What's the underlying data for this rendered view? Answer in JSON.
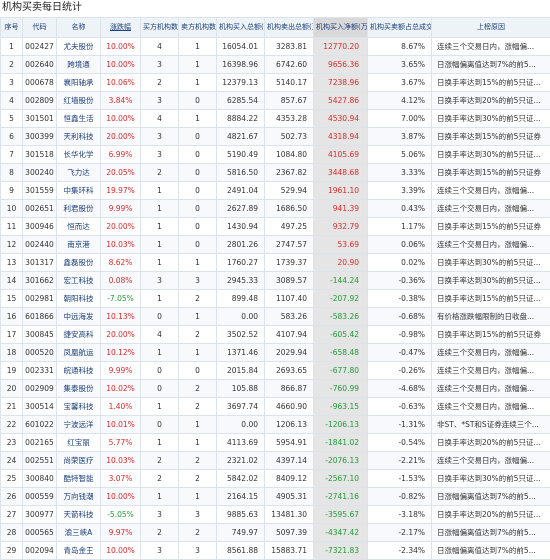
{
  "page_title": "机构买卖每日统计",
  "columns": {
    "seq": "序号",
    "code": "代码",
    "name": "名称",
    "change": "涨跌幅",
    "buyer_count": "买方机构数",
    "seller_count": "卖方机构数",
    "buy_amount": "机构买入总额(万)",
    "sell_amount": "机构卖出总额(万)",
    "net_buy": "机构买入净额(万)",
    "ratio": "机构买卖额占总成交额比",
    "reason": "上榜原因"
  },
  "colors": {
    "up": "#e12828",
    "down": "#1d9b37",
    "header_text": "#1a3e7a"
  },
  "rows": [
    {
      "seq": "1",
      "code": "002427",
      "name": "尤夫股份",
      "change": "10.00%",
      "buyers": "4",
      "sellers": "1",
      "buy": "16054.01",
      "sell": "3283.81",
      "net": "12770.20",
      "ratio": "8.67%",
      "reason": "连续三个交易日内，涨幅偏...",
      "dir": "up",
      "net_dir": "up"
    },
    {
      "seq": "2",
      "code": "002640",
      "name": "跨境通",
      "change": "10.00%",
      "buyers": "3",
      "sellers": "1",
      "buy": "16398.96",
      "sell": "6742.60",
      "net": "9656.36",
      "ratio": "3.65%",
      "reason": "日涨幅偏离值达到7%的前5...",
      "dir": "up",
      "net_dir": "up"
    },
    {
      "seq": "3",
      "code": "000678",
      "name": "襄阳轴承",
      "change": "10.06%",
      "buyers": "2",
      "sellers": "1",
      "buy": "12379.13",
      "sell": "5140.17",
      "net": "7238.96",
      "ratio": "3.67%",
      "reason": "日换手率达到15%的前5只证...",
      "dir": "up",
      "net_dir": "up"
    },
    {
      "seq": "4",
      "code": "002809",
      "name": "红墙股份",
      "change": "3.84%",
      "buyers": "3",
      "sellers": "0",
      "buy": "6285.54",
      "sell": "857.67",
      "net": "5427.86",
      "ratio": "4.12%",
      "reason": "日换手率达到20%的前5只证...",
      "dir": "up",
      "net_dir": "up"
    },
    {
      "seq": "5",
      "code": "301501",
      "name": "恒鑫生活",
      "change": "10.00%",
      "buyers": "4",
      "sellers": "1",
      "buy": "8884.22",
      "sell": "4353.28",
      "net": "4530.94",
      "ratio": "7.00%",
      "reason": "日换手率达到30%的前5只证...",
      "dir": "up",
      "net_dir": "up"
    },
    {
      "seq": "6",
      "code": "300399",
      "name": "天利科技",
      "change": "20.00%",
      "buyers": "3",
      "sellers": "0",
      "buy": "4821.67",
      "sell": "502.73",
      "net": "4318.94",
      "ratio": "3.87%",
      "reason": "日换手率达到15%的前5只证券",
      "dir": "up",
      "net_dir": "up"
    },
    {
      "seq": "7",
      "code": "301518",
      "name": "长华化学",
      "change": "6.99%",
      "buyers": "3",
      "sellers": "0",
      "buy": "5190.49",
      "sell": "1084.80",
      "net": "4105.69",
      "ratio": "5.06%",
      "reason": "日换手率达到30%的前5只证...",
      "dir": "up",
      "net_dir": "up"
    },
    {
      "seq": "8",
      "code": "300240",
      "name": "飞力达",
      "change": "20.05%",
      "buyers": "2",
      "sellers": "0",
      "buy": "5816.50",
      "sell": "2367.82",
      "net": "3448.68",
      "ratio": "3.33%",
      "reason": "日换手率达到15%的前5只证券",
      "dir": "up",
      "net_dir": "up"
    },
    {
      "seq": "9",
      "code": "301559",
      "name": "中集环科",
      "change": "19.97%",
      "buyers": "1",
      "sellers": "0",
      "buy": "2491.04",
      "sell": "529.94",
      "net": "1961.10",
      "ratio": "3.39%",
      "reason": "连续三个交易日内，涨幅偏...",
      "dir": "up",
      "net_dir": "up"
    },
    {
      "seq": "10",
      "code": "002651",
      "name": "利君股份",
      "change": "9.99%",
      "buyers": "1",
      "sellers": "0",
      "buy": "2627.89",
      "sell": "1686.50",
      "net": "941.39",
      "ratio": "0.43%",
      "reason": "连续三个交易日内，涨幅偏...",
      "dir": "up",
      "net_dir": "up"
    },
    {
      "seq": "11",
      "code": "300946",
      "name": "恒而达",
      "change": "20.00%",
      "buyers": "1",
      "sellers": "0",
      "buy": "1430.94",
      "sell": "497.25",
      "net": "932.79",
      "ratio": "1.17%",
      "reason": "日换手率达到15%的前5只证券",
      "dir": "up",
      "net_dir": "up"
    },
    {
      "seq": "12",
      "code": "002440",
      "name": "南京港",
      "change": "10.03%",
      "buyers": "1",
      "sellers": "0",
      "buy": "2801.26",
      "sell": "2747.57",
      "net": "53.69",
      "ratio": "0.06%",
      "reason": "连续三个交易日内，涨幅偏...",
      "dir": "up",
      "net_dir": "up"
    },
    {
      "seq": "13",
      "code": "301317",
      "name": "鑫磊股份",
      "change": "8.62%",
      "buyers": "1",
      "sellers": "1",
      "buy": "1760.27",
      "sell": "1739.37",
      "net": "20.90",
      "ratio": "0.02%",
      "reason": "日换手率达到30%的前5只证...",
      "dir": "up",
      "net_dir": "up"
    },
    {
      "seq": "14",
      "code": "301662",
      "name": "宏工科技",
      "change": "0.08%",
      "buyers": "3",
      "sellers": "3",
      "buy": "2945.33",
      "sell": "3089.57",
      "net": "-144.24",
      "ratio": "-0.36%",
      "reason": "日换手率达到30%的前5只证...",
      "dir": "up",
      "net_dir": "down"
    },
    {
      "seq": "15",
      "code": "002981",
      "name": "朝阳科技",
      "change": "-7.05%",
      "buyers": "1",
      "sellers": "2",
      "buy": "899.48",
      "sell": "1107.40",
      "net": "-207.92",
      "ratio": "-0.38%",
      "reason": "日换手率达到15%的前5只证...",
      "dir": "down",
      "net_dir": "down"
    },
    {
      "seq": "16",
      "code": "601866",
      "name": "中远海发",
      "change": "10.13%",
      "buyers": "0",
      "sellers": "1",
      "buy": "0.00",
      "sell": "583.26",
      "net": "-583.26",
      "ratio": "-0.68%",
      "reason": "有价格涨跌幅限制的日收盘...",
      "dir": "up",
      "net_dir": "down"
    },
    {
      "seq": "17",
      "code": "300845",
      "name": "捷安高科",
      "change": "20.00%",
      "buyers": "4",
      "sellers": "2",
      "buy": "3502.52",
      "sell": "4107.94",
      "net": "-605.42",
      "ratio": "-0.98%",
      "reason": "日换手率达到15%的前5只证券",
      "dir": "up",
      "net_dir": "down"
    },
    {
      "seq": "18",
      "code": "000520",
      "name": "凤凰航运",
      "change": "10.12%",
      "buyers": "1",
      "sellers": "1",
      "buy": "1371.46",
      "sell": "2029.94",
      "net": "-658.48",
      "ratio": "-0.47%",
      "reason": "连续三个交易日内，涨幅偏...",
      "dir": "up",
      "net_dir": "down"
    },
    {
      "seq": "19",
      "code": "002331",
      "name": "皖通科技",
      "change": "9.99%",
      "buyers": "0",
      "sellers": "0",
      "buy": "2015.84",
      "sell": "2693.65",
      "net": "-677.80",
      "ratio": "-0.26%",
      "reason": "连续三个交易日内，涨幅偏...",
      "dir": "up",
      "net_dir": "down"
    },
    {
      "seq": "20",
      "code": "002909",
      "name": "集泰股份",
      "change": "10.02%",
      "buyers": "0",
      "sellers": "2",
      "buy": "105.88",
      "sell": "866.87",
      "net": "-760.99",
      "ratio": "-4.68%",
      "reason": "连续三个交易日内，涨幅偏...",
      "dir": "up",
      "net_dir": "down"
    },
    {
      "seq": "21",
      "code": "300514",
      "name": "宝馨科技",
      "change": "1.40%",
      "buyers": "1",
      "sellers": "2",
      "buy": "3697.74",
      "sell": "4660.90",
      "net": "-963.15",
      "ratio": "-0.63%",
      "reason": "连续三个交易日内，涨幅偏...",
      "dir": "up",
      "net_dir": "down"
    },
    {
      "seq": "22",
      "code": "601022",
      "name": "宁波远洋",
      "change": "10.01%",
      "buyers": "0",
      "sellers": "1",
      "buy": "0.00",
      "sell": "1206.13",
      "net": "-1206.13",
      "ratio": "-1.31%",
      "reason": "非ST、*ST和S证券连续三个...",
      "dir": "up",
      "net_dir": "down"
    },
    {
      "seq": "23",
      "code": "002165",
      "name": "红宝丽",
      "change": "5.77%",
      "buyers": "1",
      "sellers": "1",
      "buy": "4113.69",
      "sell": "5954.91",
      "net": "-1841.02",
      "ratio": "-0.54%",
      "reason": "日换手率达到20%的前5只证...",
      "dir": "up",
      "net_dir": "down"
    },
    {
      "seq": "24",
      "code": "002551",
      "name": "尚荣医疗",
      "change": "10.03%",
      "buyers": "2",
      "sellers": "2",
      "buy": "2321.02",
      "sell": "4397.14",
      "net": "-2076.13",
      "ratio": "-2.21%",
      "reason": "连续三个交易日内，涨幅偏...",
      "dir": "up",
      "net_dir": "down"
    },
    {
      "seq": "25",
      "code": "300840",
      "name": "酷特智能",
      "change": "3.07%",
      "buyers": "2",
      "sellers": "2",
      "buy": "5842.02",
      "sell": "8409.12",
      "net": "-2567.10",
      "ratio": "-1.53%",
      "reason": "日换手率达到30%的前5只证...",
      "dir": "up",
      "net_dir": "down"
    },
    {
      "seq": "26",
      "code": "000559",
      "name": "万向钱潮",
      "change": "10.00%",
      "buyers": "1",
      "sellers": "1",
      "buy": "2164.15",
      "sell": "4905.31",
      "net": "-2741.16",
      "ratio": "-0.82%",
      "reason": "日涨幅偏离值达到7%的前5...",
      "dir": "up",
      "net_dir": "down"
    },
    {
      "seq": "27",
      "code": "300977",
      "name": "天箭科技",
      "change": "-5.05%",
      "buyers": "3",
      "sellers": "3",
      "buy": "9885.63",
      "sell": "13481.30",
      "net": "-3595.67",
      "ratio": "-3.18%",
      "reason": "日换手率达到20%的前5只证...",
      "dir": "down",
      "net_dir": "down"
    },
    {
      "seq": "28",
      "code": "000565",
      "name": "渝三峡A",
      "change": "9.97%",
      "buyers": "2",
      "sellers": "2",
      "buy": "749.97",
      "sell": "5097.39",
      "net": "-4347.42",
      "ratio": "-2.17%",
      "reason": "日涨幅偏离值达到7%的前5...",
      "dir": "up",
      "net_dir": "down"
    },
    {
      "seq": "29",
      "code": "002094",
      "name": "青岛金王",
      "change": "10.00%",
      "buyers": "3",
      "sellers": "3",
      "buy": "8561.88",
      "sell": "15883.71",
      "net": "-7321.83",
      "ratio": "-2.34%",
      "reason": "日涨幅偏离值达到7%的前5...",
      "dir": "up",
      "net_dir": "down"
    }
  ]
}
